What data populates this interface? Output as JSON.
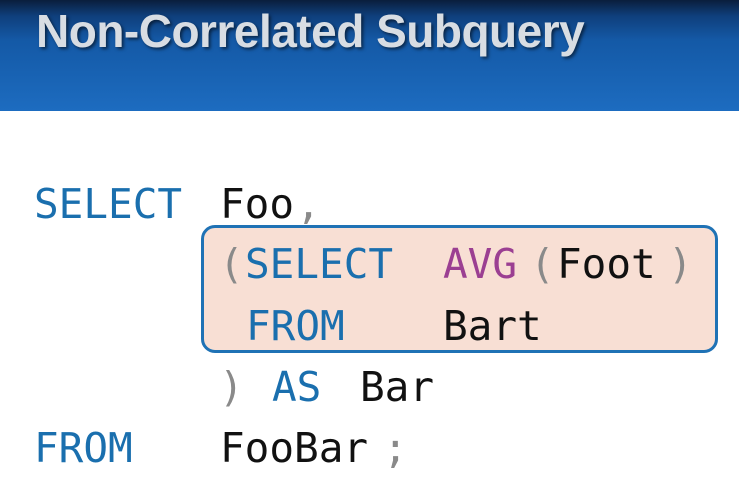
{
  "slide": {
    "title": "Non-Correlated Subquery"
  },
  "code": {
    "line1": {
      "keyword": "SELECT",
      "column": "Foo",
      "comma": ","
    },
    "line2": {
      "open_paren": "(",
      "keyword": "SELECT",
      "function": "AVG",
      "fn_open": "(",
      "arg": "Foot",
      "fn_close": ")"
    },
    "line3": {
      "keyword": "FROM",
      "table": "Bart"
    },
    "line4": {
      "close_paren": ")",
      "keyword": "AS",
      "alias": "Bar"
    },
    "line5": {
      "keyword": "FROM",
      "table": "FooBar",
      "semicolon": ";"
    }
  },
  "colors": {
    "keyword": "#1a6fae",
    "function": "#9b3f92",
    "identifier": "#111111",
    "punctuation": "#8a8a8a",
    "highlight_fill": "#f8dfd4",
    "highlight_border": "#1f72b5",
    "title_bar": "#1459a6"
  }
}
